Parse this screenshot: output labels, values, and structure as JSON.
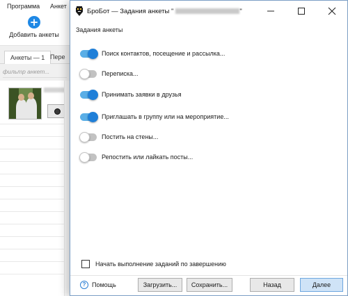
{
  "background_app": {
    "menu": [
      "Программа",
      "Анкет"
    ],
    "add_button_label": "Добавить анкеты",
    "tabs": [
      "Анкеты — 1",
      "Пере"
    ],
    "filter_placeholder": "фильтр анкет..."
  },
  "dialog": {
    "title": "БроБот — Задания анкеты \"",
    "title_suffix": "\"",
    "section_title": "Задания анкеты",
    "options": [
      {
        "label": "Поиск контактов, посещение и рассылка...",
        "on": true
      },
      {
        "label": "Переписка...",
        "on": false
      },
      {
        "label": "Принимать заявки в друзья",
        "on": true
      },
      {
        "label": "Приглашать в группу или на мероприятие...",
        "on": true
      },
      {
        "label": "Постить на стены...",
        "on": false
      },
      {
        "label": "Репостить или лайкать посты...",
        "on": false
      }
    ],
    "start_on_finish_label": "Начать выполнение заданий по завершению",
    "start_on_finish_checked": false,
    "help_label": "Помощь",
    "buttons": {
      "load": "Загрузить...",
      "save": "Сохранить...",
      "back": "Назад",
      "next": "Далее"
    }
  },
  "colors": {
    "toggle_on_track": "#5aaee6",
    "toggle_on_knob": "#1f7fd8",
    "accent": "#1e88e5"
  },
  "icons": [
    "plus-icon",
    "record-icon",
    "bot-app-icon",
    "minimize-icon",
    "maximize-icon",
    "close-icon",
    "help-icon"
  ]
}
